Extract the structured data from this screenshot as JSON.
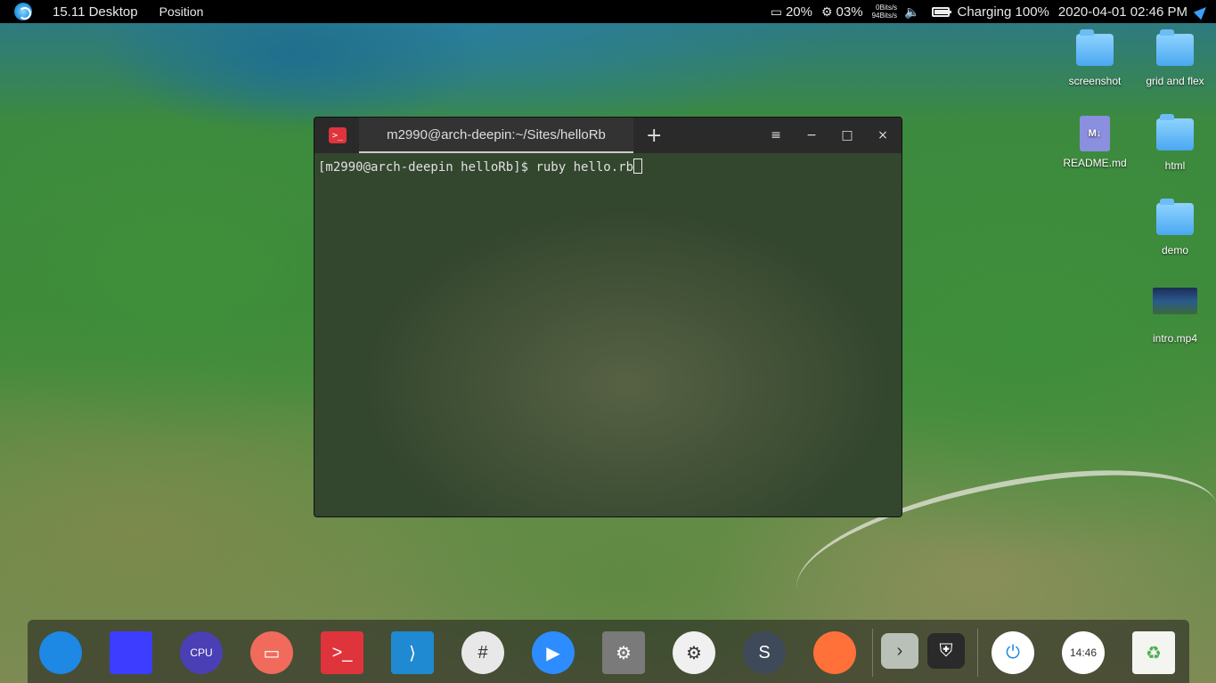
{
  "top_panel": {
    "workspace": "15.11 Desktop",
    "menu": "Position",
    "memory_usage": "20%",
    "cpu_usage": "03%",
    "net_up": "0Bits/s",
    "net_down": "94Bits/s",
    "battery": "Charging 100%",
    "battery_level": 1.0,
    "datetime": "2020-04-01 02:46 PM"
  },
  "desktop_icons": [
    {
      "label": "screenshot",
      "kind": "folder"
    },
    {
      "label": "grid and flex",
      "kind": "folder"
    },
    {
      "label": "README.md",
      "kind": "markdown",
      "badge": "M↓"
    },
    {
      "label": "html",
      "kind": "folder"
    },
    {
      "label": "demo",
      "kind": "folder"
    },
    {
      "label": "intro.mp4",
      "kind": "video"
    }
  ],
  "terminal": {
    "app_icon": ">_",
    "tab_title": "m2990@arch-deepin:~/Sites/helloRb",
    "add_tab": "+",
    "menu": "≡",
    "minimize": "−",
    "maximize": "□",
    "close": "×",
    "prompt": "[m2990@arch-deepin helloRb]$ ",
    "command": "ruby hello.rb"
  },
  "dock": {
    "items": [
      {
        "name": "launcher-icon",
        "glyph": "",
        "color": "#1e88e5"
      },
      {
        "name": "computer-icon",
        "glyph": "",
        "color": "#3d3dff"
      },
      {
        "name": "system-monitor-icon",
        "glyph": "CPU",
        "color": "#4a3fb4"
      },
      {
        "name": "presentation-icon",
        "glyph": "▭",
        "color": "#f06b5b"
      },
      {
        "name": "terminal-icon",
        "glyph": ">_",
        "color": "#e0343c"
      },
      {
        "name": "vscode-icon",
        "glyph": "⟩",
        "color": "#1f8ad2"
      },
      {
        "name": "slack-icon",
        "glyph": "#",
        "color": "#e8e8e8"
      },
      {
        "name": "zoom-icon",
        "glyph": "▶",
        "color": "#2d8cff"
      },
      {
        "name": "disk-utility-icon",
        "glyph": "⚙",
        "color": "#7a7a7a"
      },
      {
        "name": "settings-icon",
        "glyph": "⚙",
        "color": "#f0f0f0"
      },
      {
        "name": "sublime-icon",
        "glyph": "S",
        "color": "#3e4a5a"
      },
      {
        "name": "firefox-icon",
        "glyph": "",
        "color": "#ff7139"
      },
      {
        "name": "tray-expand-icon",
        "glyph": "›",
        "color": "#b8c0b8"
      },
      {
        "name": "vpn-icon",
        "glyph": "⛨",
        "color": "#2a2a2a"
      },
      {
        "name": "power-icon",
        "glyph": "⏻",
        "color": "#ffffff"
      },
      {
        "name": "clock-icon",
        "glyph": "14:46",
        "color": "#ffffff"
      },
      {
        "name": "trash-icon",
        "glyph": "♻",
        "color": "#f4f4f0"
      }
    ]
  }
}
